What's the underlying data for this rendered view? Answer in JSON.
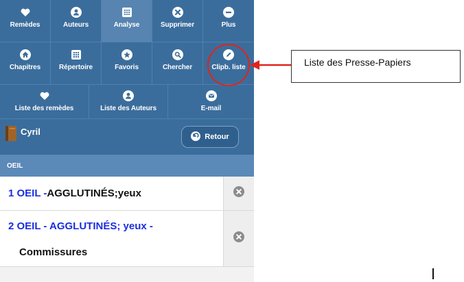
{
  "toolbar": {
    "row1": [
      {
        "label": "Remèdes",
        "icon": "heart-icon"
      },
      {
        "label": "Auteurs",
        "icon": "person-icon"
      },
      {
        "label": "Analyse",
        "icon": "grid-icon",
        "active": true
      },
      {
        "label": "Supprimer",
        "icon": "close-circle-icon"
      },
      {
        "label": "Plus",
        "icon": "minus-circle-icon"
      }
    ],
    "row2": [
      {
        "label": "Chapitres",
        "icon": "home-icon"
      },
      {
        "label": "Répertoire",
        "icon": "grid-icon"
      },
      {
        "label": "Favoris",
        "icon": "star-icon"
      },
      {
        "label": "Chercher",
        "icon": "search-icon"
      },
      {
        "label": "Clipb. liste",
        "icon": "pencil-icon"
      }
    ],
    "row3": [
      {
        "label": "Liste des remèdes",
        "icon": "heart-icon"
      },
      {
        "label": "Liste des Auteurs",
        "icon": "person-icon"
      },
      {
        "label": "E-mail",
        "icon": "mail-icon"
      }
    ]
  },
  "header": {
    "title": "Cyril",
    "back_label": "Retour"
  },
  "section": {
    "label": "OEIL"
  },
  "entries": [
    {
      "prefix": "1 OEIL -",
      "rest": "AGGLUTINÉS;yeux"
    },
    {
      "line1": "2 OEIL - AGGLUTINÉS; yeux -",
      "line2": "Commissures"
    }
  ],
  "callout": {
    "text": "Liste des Presse-Papiers",
    "color": "#e0241b"
  },
  "colors": {
    "toolbar": "#3b6d9c",
    "active": "#5784b0",
    "section": "#5b89b8",
    "link": "#1a2ee0"
  }
}
